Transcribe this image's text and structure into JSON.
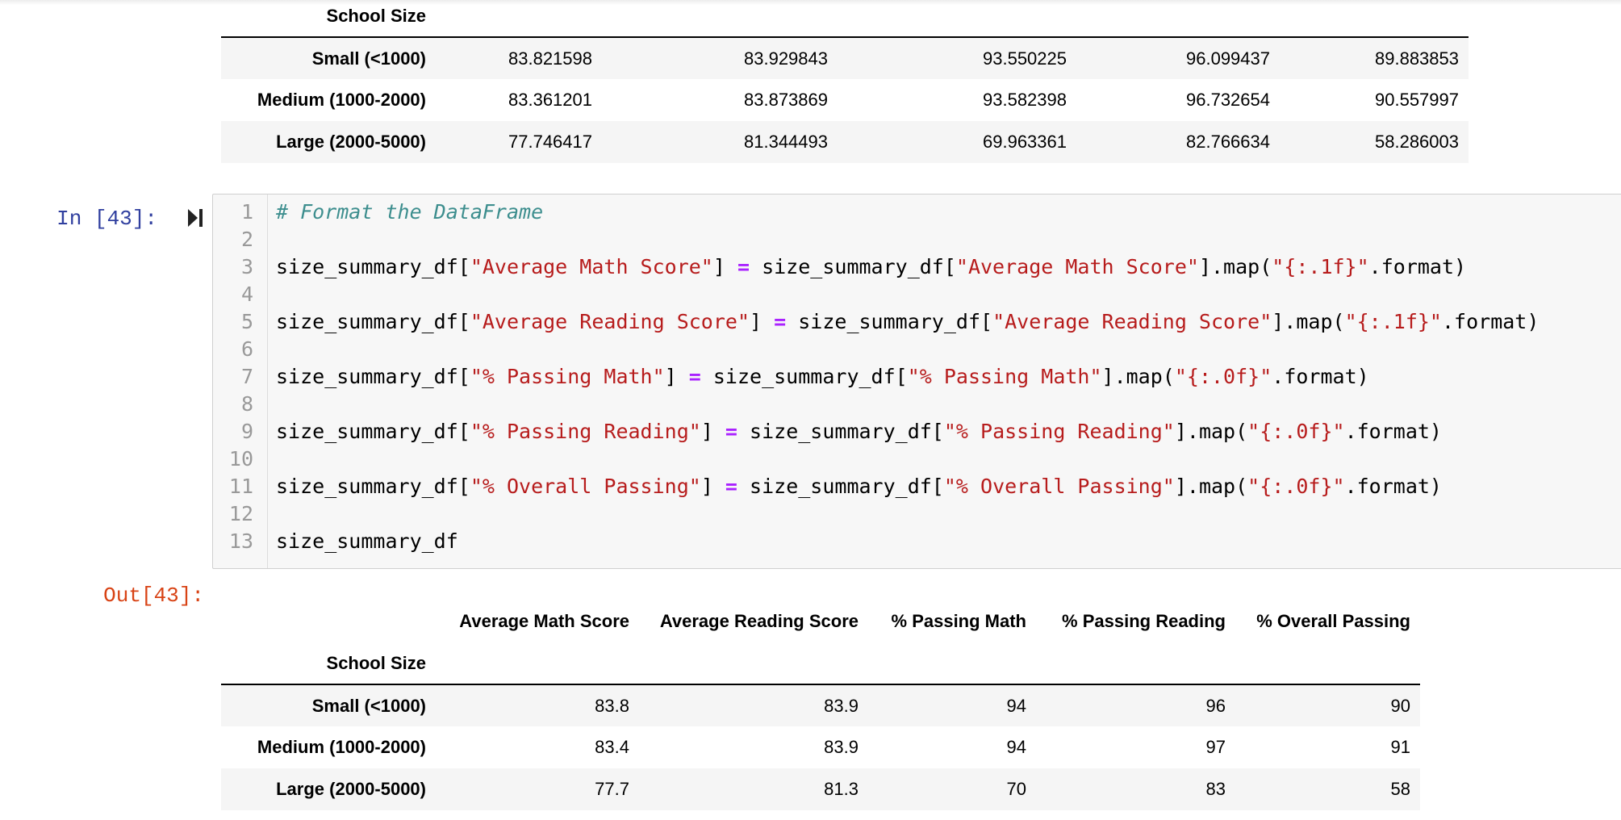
{
  "table_top": {
    "index_name": "School Size",
    "rows": [
      {
        "label": "Small (<1000)",
        "values": [
          "83.821598",
          "83.929843",
          "93.550225",
          "96.099437",
          "89.883853"
        ]
      },
      {
        "label": "Medium (1000-2000)",
        "values": [
          "83.361201",
          "83.873869",
          "93.582398",
          "96.732654",
          "90.557997"
        ]
      },
      {
        "label": "Large (2000-5000)",
        "values": [
          "77.746417",
          "81.344493",
          "69.963361",
          "82.766634",
          "58.286003"
        ]
      }
    ]
  },
  "cell": {
    "in_prompt": "In [43]:",
    "out_prompt": "Out[43]:",
    "lines": [
      {
        "n": "1",
        "comment": "# Format the DataFrame"
      },
      {
        "n": "2"
      },
      {
        "n": "3",
        "lhs_obj": "size_summary_df[",
        "key": "\"Average Math Score\"",
        "lhs_close": "] ",
        "op": "=",
        "rhs_obj": " size_summary_df[",
        "rhs_close": "].map(",
        "fmt": "\"{:.1f}\"",
        "tail": ".format)"
      },
      {
        "n": "4"
      },
      {
        "n": "5",
        "lhs_obj": "size_summary_df[",
        "key": "\"Average Reading Score\"",
        "lhs_close": "] ",
        "op": "=",
        "rhs_obj": " size_summary_df[",
        "rhs_close": "].map(",
        "fmt": "\"{:.1f}\"",
        "tail": ".format)"
      },
      {
        "n": "6"
      },
      {
        "n": "7",
        "lhs_obj": "size_summary_df[",
        "key": "\"% Passing Math\"",
        "lhs_close": "] ",
        "op": "=",
        "rhs_obj": " size_summary_df[",
        "rhs_close": "].map(",
        "fmt": "\"{:.0f}\"",
        "tail": ".format)"
      },
      {
        "n": "8"
      },
      {
        "n": "9",
        "lhs_obj": "size_summary_df[",
        "key": "\"% Passing Reading\"",
        "lhs_close": "] ",
        "op": "=",
        "rhs_obj": " size_summary_df[",
        "rhs_close": "].map(",
        "fmt": "\"{:.0f}\"",
        "tail": ".format)"
      },
      {
        "n": "10"
      },
      {
        "n": "11",
        "lhs_obj": "size_summary_df[",
        "key": "\"% Overall Passing\"",
        "lhs_close": "] ",
        "op": "=",
        "rhs_obj": " size_summary_df[",
        "rhs_close": "].map(",
        "fmt": "\"{:.0f}\"",
        "tail": ".format)"
      },
      {
        "n": "12"
      },
      {
        "n": "13",
        "plain": "size_summary_df"
      }
    ]
  },
  "table_out": {
    "columns": [
      "Average Math Score",
      "Average Reading Score",
      "% Passing Math",
      "% Passing Reading",
      "% Overall Passing"
    ],
    "index_name": "School Size",
    "rows": [
      {
        "label": "Small (<1000)",
        "values": [
          "83.8",
          "83.9",
          "94",
          "96",
          "90"
        ]
      },
      {
        "label": "Medium (1000-2000)",
        "values": [
          "83.4",
          "83.9",
          "94",
          "97",
          "91"
        ]
      },
      {
        "label": "Large (2000-5000)",
        "values": [
          "77.7",
          "81.3",
          "70",
          "83",
          "58"
        ]
      }
    ]
  },
  "colors": {
    "in_prompt": "#303f9f",
    "out_prompt": "#d84315",
    "string": "#b71c1c",
    "comment": "#3d8e8e",
    "operator": "#aa22ff"
  },
  "icons": {
    "run": "run-cell-icon"
  }
}
